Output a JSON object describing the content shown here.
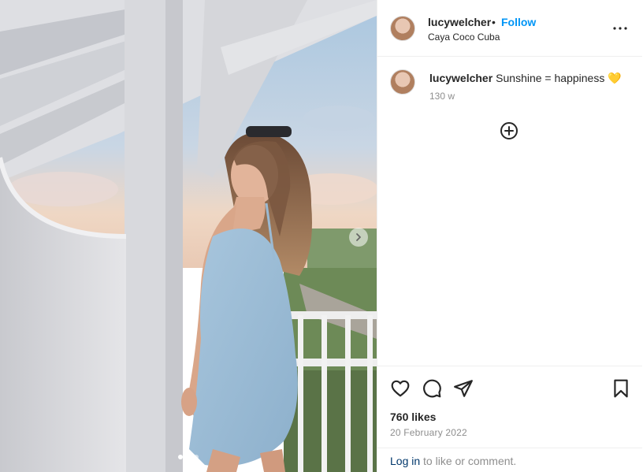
{
  "post": {
    "username": "lucywelcher",
    "separator": "•",
    "follow_label": "Follow",
    "location": "Caya Coco Cuba",
    "more_icon": "more-horizontal-icon"
  },
  "caption": {
    "username": "lucywelcher",
    "text": "Sunshine = happiness",
    "emoji": "💛",
    "time": "130 w"
  },
  "media": {
    "carousel": {
      "slides": 3,
      "active": 0
    },
    "next_icon": "chevron-right-icon"
  },
  "actions": {
    "like_icon": "heart-icon",
    "comment_icon": "comment-icon",
    "share_icon": "share-icon",
    "save_icon": "bookmark-icon",
    "add_comment_icon": "plus-circle-icon"
  },
  "stats": {
    "likes": "760 likes",
    "date": "20 February 2022"
  },
  "login": {
    "link": "Log in",
    "rest": " to like or comment."
  },
  "colors": {
    "link_blue": "#0095f6",
    "text": "#262626",
    "muted": "#8e8e8e",
    "border": "#efefef"
  }
}
